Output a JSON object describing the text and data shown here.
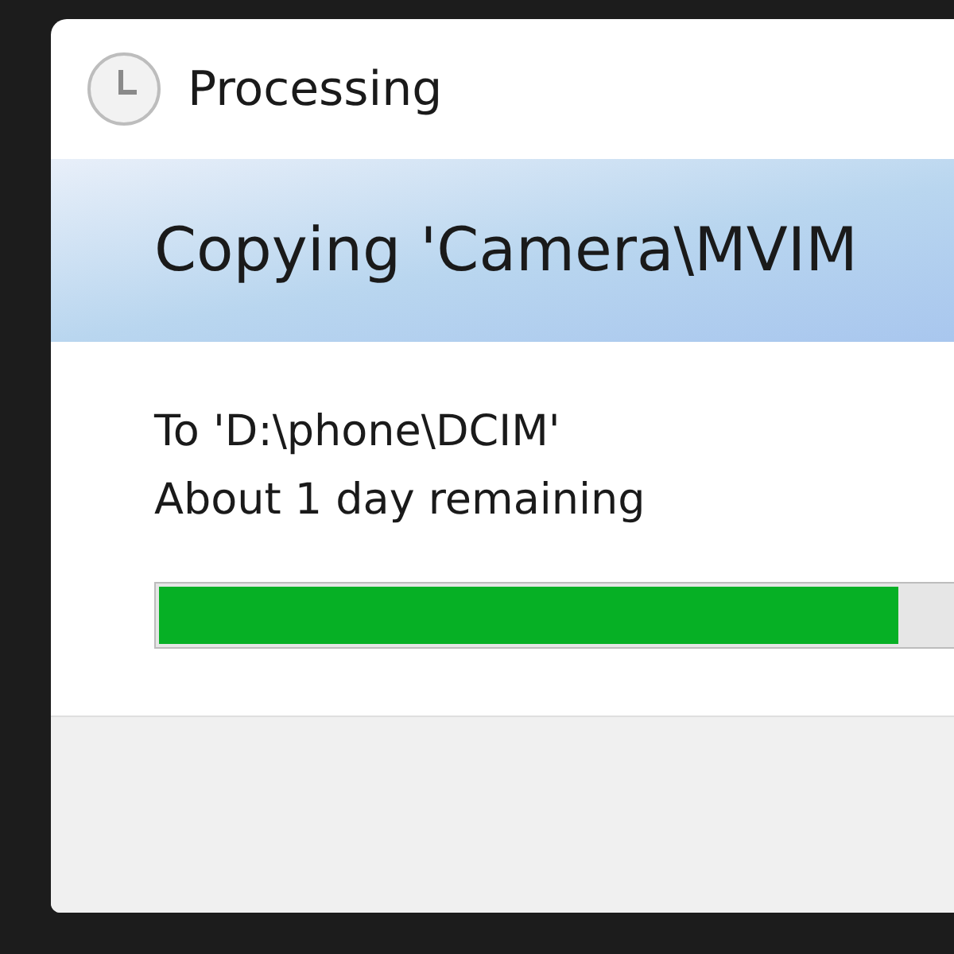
{
  "window": {
    "title": "Processing"
  },
  "header": {
    "text": "Copying 'Camera\\MVIM"
  },
  "details": [
    "To 'D:\\phone\\DCIM'",
    "About 1 day remaining"
  ],
  "progress": {
    "level": 0.84
  }
}
